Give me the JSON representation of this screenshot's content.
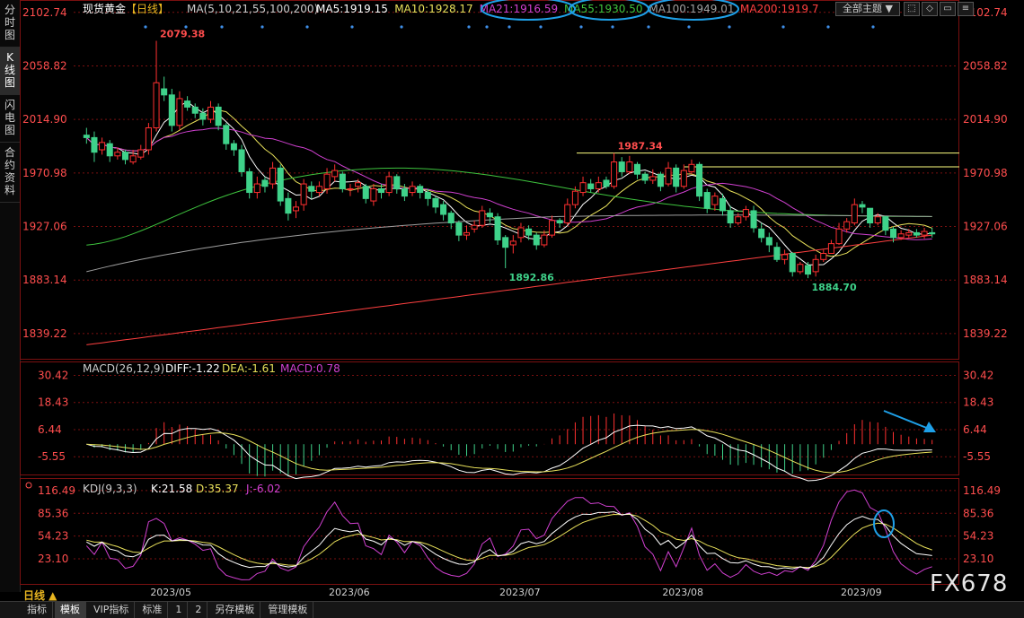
{
  "side_tabs": [
    "分时图",
    "K线图",
    "闪电图",
    "合约资料"
  ],
  "active_side_tab": 1,
  "period_tab": "日线 ▲",
  "bottom_tabs": [
    "指标",
    "模板",
    "VIP指标",
    "标准",
    "1",
    "2",
    "另存模板",
    "管理模板"
  ],
  "active_bottom_tab": 1,
  "toolbar": {
    "theme_label": "全部主题",
    "theme_arrow": "▼",
    "buttons": [
      "⬚",
      "◇",
      "▭",
      "≡"
    ]
  },
  "watermark": "FX678",
  "main_panel": {
    "instrument": "现货黄金",
    "period": "【日线】",
    "ma_label": "MA(5,10,21,55,100,200)",
    "ma_values": [
      {
        "label": "MA5:1919.15",
        "color": "#ffffff"
      },
      {
        "label": "MA10:1928.17",
        "color": "#e8e05a"
      },
      {
        "label": "MA21:1916.59",
        "color": "#d040d0"
      },
      {
        "label": "MA55:1930.50",
        "color": "#3ec43e"
      },
      {
        "label": "MA100:1949.01",
        "color": "#a0a0a0"
      },
      {
        "label": "MA200:1919.7",
        "color": "#ff4040"
      }
    ],
    "price_ticks": [
      "2102.74",
      "2058.82",
      "2014.90",
      "1970.98",
      "1927.06",
      "1883.14",
      "1839.22"
    ],
    "annotations": [
      "2079.38",
      "1987.34",
      "1892.86",
      "1884.70"
    ],
    "ylim": [
      1820,
      2107
    ]
  },
  "macd_panel": {
    "label": "MACD(26,12,9)",
    "diff": "DIFF:-1.22",
    "dea": "DEA:-1.61",
    "macd": "MACD:0.78",
    "ticks": [
      "30.42",
      "18.43",
      "6.44",
      "-5.55"
    ],
    "ylim": [
      -13,
      33
    ]
  },
  "kdj_panel": {
    "label": "KDJ(9,3,3)",
    "k": "K:21.58",
    "d": "D:35.37",
    "j": "J:-6.02",
    "ticks": [
      "116.49",
      "85.36",
      "54.23",
      "23.10"
    ],
    "ylim": [
      -10,
      125
    ]
  },
  "x_labels": [
    "2023/05",
    "2023/06",
    "2023/07",
    "2023/08",
    "2023/09"
  ],
  "colors": {
    "up": "#ff3030",
    "down": "#3fd28a",
    "grid": "#7a1010",
    "price_text": "#ff4d4d",
    "text": "#c8c8c8"
  },
  "chart_data": {
    "type": "candlestick",
    "open": [
      2002,
      2000,
      1990,
      1995,
      1985,
      1988,
      1980,
      1984,
      1990,
      2008,
      2040,
      2035,
      2010,
      2030,
      2025,
      2020,
      2015,
      2025,
      2010,
      1995,
      1990,
      1972,
      1955,
      1965,
      1962,
      1975,
      1950,
      1940,
      1945,
      1960,
      1955,
      1958,
      1968,
      1970,
      1958,
      1960,
      1960,
      1948,
      1958,
      1955,
      1968,
      1958,
      1955,
      1960,
      1955,
      1950,
      1945,
      1938,
      1930,
      1920,
      1925,
      1928,
      1938,
      1935,
      1918,
      1912,
      1918,
      1925,
      1920,
      1912,
      1920,
      1932,
      1930,
      1945,
      1955,
      1962,
      1958,
      1965,
      1960,
      1980,
      1972,
      1978,
      1970,
      1965,
      1970,
      1962,
      1975,
      1960,
      1972,
      1978,
      1955,
      1945,
      1950,
      1940,
      1930,
      1935,
      1940,
      1925,
      1918,
      1910,
      1900,
      1905,
      1890,
      1895,
      1890,
      1900,
      1905,
      1913,
      1925,
      1930,
      1945,
      1942,
      1930,
      1935,
      1925,
      1918,
      1920,
      1922,
      1920,
      1922
    ],
    "close": [
      2000,
      1988,
      1996,
      1985,
      1988,
      1982,
      1985,
      1990,
      2008,
      2045,
      2035,
      2010,
      2032,
      2025,
      2020,
      2015,
      2025,
      2010,
      1995,
      1990,
      1972,
      1955,
      1962,
      1960,
      1975,
      1948,
      1938,
      1943,
      1962,
      1956,
      1960,
      1970,
      1973,
      1958,
      1958,
      1963,
      1950,
      1958,
      1955,
      1968,
      1958,
      1952,
      1960,
      1955,
      1950,
      1943,
      1937,
      1930,
      1920,
      1922,
      1928,
      1940,
      1935,
      1916,
      1910,
      1915,
      1926,
      1920,
      1912,
      1920,
      1932,
      1930,
      1945,
      1956,
      1963,
      1958,
      1963,
      1960,
      1980,
      1972,
      1980,
      1970,
      1965,
      1968,
      1960,
      1975,
      1960,
      1973,
      1978,
      1952,
      1942,
      1952,
      1940,
      1930,
      1935,
      1941,
      1926,
      1918,
      1912,
      1900,
      1904,
      1890,
      1896,
      1888,
      1900,
      1905,
      1913,
      1925,
      1931,
      1945,
      1943,
      1930,
      1935,
      1924,
      1918,
      1921,
      1922,
      1920,
      1923,
      1921
    ],
    "high": [
      2008,
      2005,
      2000,
      1998,
      1992,
      1990,
      1990,
      1994,
      2012,
      2079.38,
      2050,
      2040,
      2038,
      2034,
      2028,
      2024,
      2030,
      2028,
      2012,
      1998,
      1994,
      1975,
      1968,
      1968,
      1980,
      1978,
      1955,
      1948,
      1966,
      1964,
      1964,
      1975,
      1978,
      1972,
      1962,
      1966,
      1962,
      1962,
      1962,
      1972,
      1970,
      1962,
      1964,
      1962,
      1958,
      1952,
      1948,
      1940,
      1932,
      1928,
      1932,
      1944,
      1942,
      1938,
      1920,
      1920,
      1930,
      1928,
      1922,
      1924,
      1936,
      1934,
      1950,
      1960,
      1968,
      1966,
      1968,
      1968,
      1987.34,
      1984,
      1985,
      1980,
      1972,
      1974,
      1972,
      1980,
      1978,
      1978,
      1982,
      1980,
      1958,
      1955,
      1954,
      1944,
      1938,
      1944,
      1944,
      1930,
      1922,
      1914,
      1908,
      1906,
      1898,
      1898,
      1904,
      1908,
      1916,
      1930,
      1934,
      1950,
      1948,
      1942,
      1938,
      1936,
      1927,
      1924,
      1925,
      1925,
      1926,
      1926
    ],
    "low": [
      1995,
      1980,
      1986,
      1980,
      1982,
      1978,
      1978,
      1982,
      1986,
      2005,
      2030,
      2005,
      2006,
      2022,
      2016,
      2010,
      2012,
      2006,
      1990,
      1985,
      1968,
      1950,
      1950,
      1955,
      1958,
      1944,
      1932,
      1934,
      1940,
      1950,
      1952,
      1954,
      1964,
      1955,
      1952,
      1955,
      1946,
      1944,
      1950,
      1952,
      1954,
      1948,
      1952,
      1950,
      1944,
      1938,
      1932,
      1925,
      1915,
      1916,
      1922,
      1926,
      1930,
      1912,
      1892.86,
      1905,
      1914,
      1916,
      1908,
      1910,
      1918,
      1926,
      1928,
      1942,
      1952,
      1955,
      1955,
      1958,
      1958,
      1968,
      1970,
      1966,
      1962,
      1962,
      1956,
      1960,
      1955,
      1958,
      1970,
      1948,
      1938,
      1940,
      1936,
      1926,
      1928,
      1932,
      1922,
      1914,
      1906,
      1898,
      1896,
      1886,
      1888,
      1884.7,
      1886,
      1898,
      1906,
      1912,
      1922,
      1928,
      1938,
      1926,
      1928,
      1920,
      1914,
      1916,
      1918,
      1918,
      1917,
      1918
    ]
  }
}
